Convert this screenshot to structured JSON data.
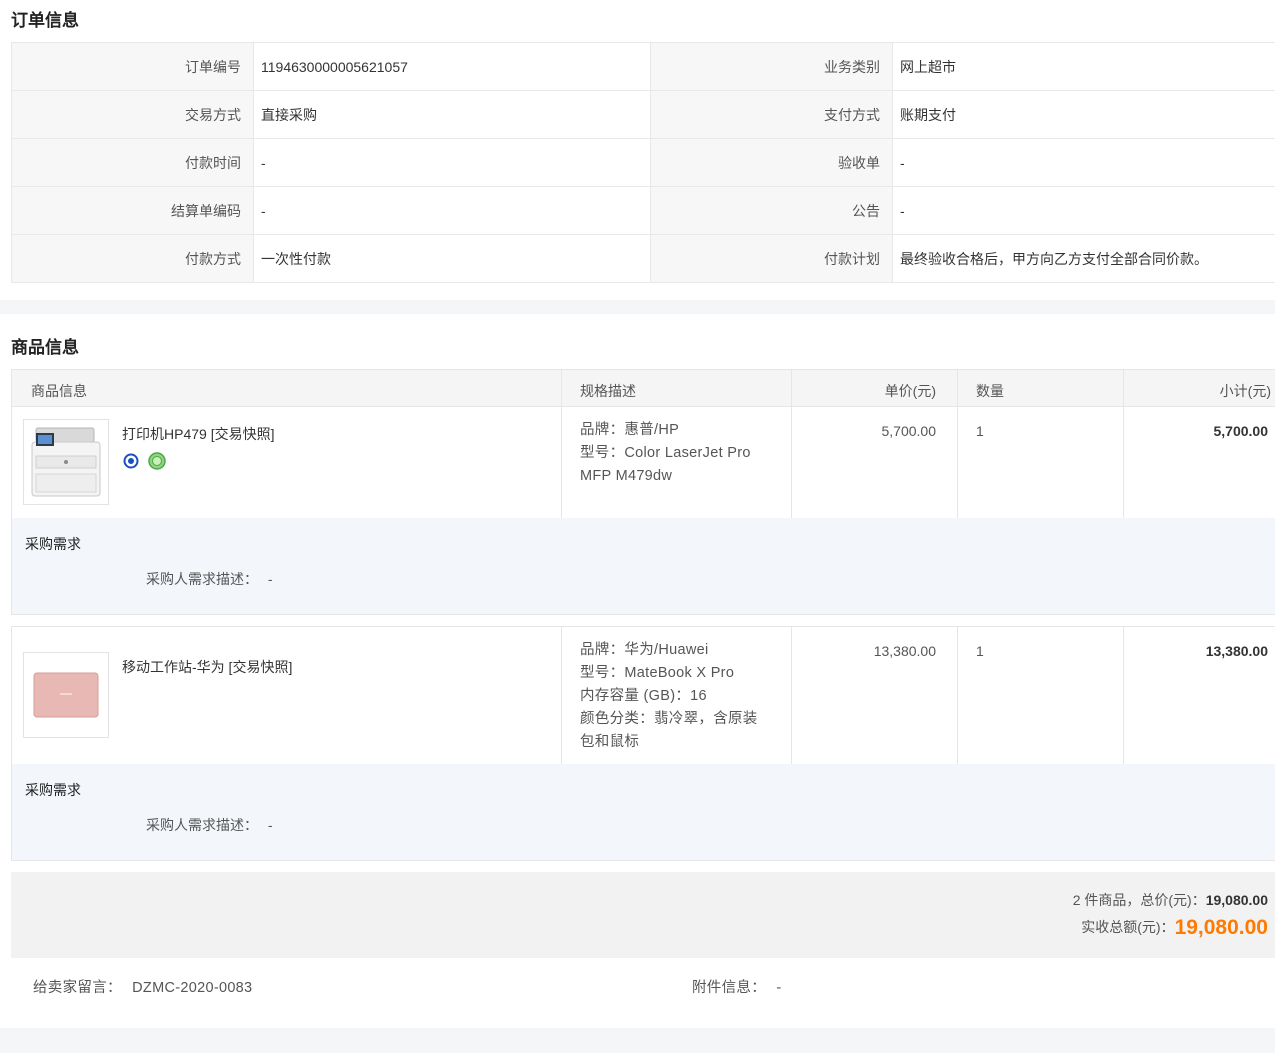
{
  "order_section": {
    "title": "订单信息",
    "rows": [
      {
        "l1": "订单编号",
        "v1": "1194630000005621057",
        "l2": "业务类别",
        "v2": "网上超市"
      },
      {
        "l1": "交易方式",
        "v1": "直接采购",
        "l2": "支付方式",
        "v2": "账期支付"
      },
      {
        "l1": "付款时间",
        "v1": "-",
        "l2": "验收单",
        "v2": "-"
      },
      {
        "l1": "结算单编码",
        "v1": "-",
        "l2": "公告",
        "v2": "-"
      },
      {
        "l1": "付款方式",
        "v1": "一次性付款",
        "l2": "付款计划",
        "v2": "最终验收合格后，甲方向乙方支付全部合同价款。"
      }
    ]
  },
  "goods_section": {
    "title": "商品信息",
    "columns": [
      "商品信息",
      "规格描述",
      "单价(元)",
      "数量",
      "小计(元)"
    ],
    "items": [
      {
        "name": "打印机HP479 [交易快照]",
        "spec": [
          "品牌：惠普/HP",
          "型号：Color LaserJet Pro",
          "MFP M479dw"
        ],
        "price": "5,700.00",
        "qty": "1",
        "subtotal": "5,700.00",
        "req_title": "采购需求",
        "req_label": "采购人需求描述：",
        "req_value": "-",
        "thumb_icon": "printer-thumbnail",
        "badges": [
          "energy-saving-badge",
          "environmental-badge"
        ]
      },
      {
        "name": "移动工作站-华为 [交易快照]",
        "spec": [
          "品牌：华为/Huawei",
          "型号：MateBook X Pro",
          "内存容量 (GB)：16",
          "颜色分类：翡冷翠，含原装",
          "包和鼠标"
        ],
        "price": "13,380.00",
        "qty": "1",
        "subtotal": "13,380.00",
        "req_title": "采购需求",
        "req_label": "采购人需求描述：",
        "req_value": "-",
        "thumb_icon": "laptop-thumbnail"
      }
    ]
  },
  "totals": {
    "count_text": "2 件商品，总价(元)：",
    "total_price": "19,080.00",
    "received_label": "实收总额(元)：",
    "received_amount": "19,080.00"
  },
  "footer": {
    "message_label": "给卖家留言：",
    "message_value": "DZMC-2020-0083",
    "attachment_label": "附件信息：",
    "attachment_value": "-"
  },
  "colors": {
    "accent_orange": "#ff7a00",
    "req_bg": "#f3f7fc",
    "label_bg": "#f7f7f7"
  }
}
